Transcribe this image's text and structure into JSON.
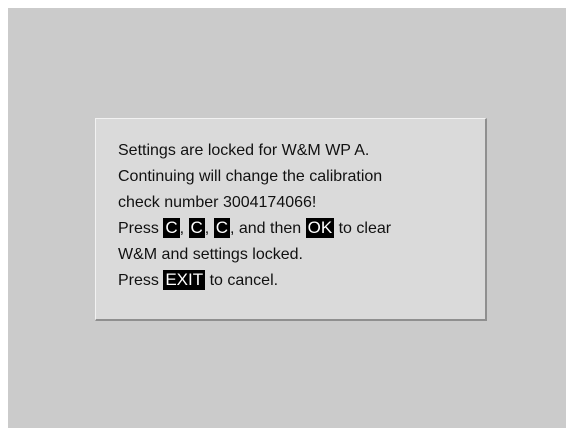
{
  "dialog": {
    "line1": "Settings are locked for W&M WP A.",
    "line2": "Continuing will change the calibration",
    "line3": "check number 3004174066!",
    "line4": {
      "prefix": "Press ",
      "key1": "C",
      "sep1": ", ",
      "key2": "C",
      "sep2": ", ",
      "key3": "C",
      "mid": ", and then ",
      "key_ok": "OK",
      "suffix": " to clear"
    },
    "line5": "W&M and settings locked.",
    "line6": {
      "prefix": "Press ",
      "key_exit": "EXIT",
      "suffix": " to cancel."
    }
  }
}
